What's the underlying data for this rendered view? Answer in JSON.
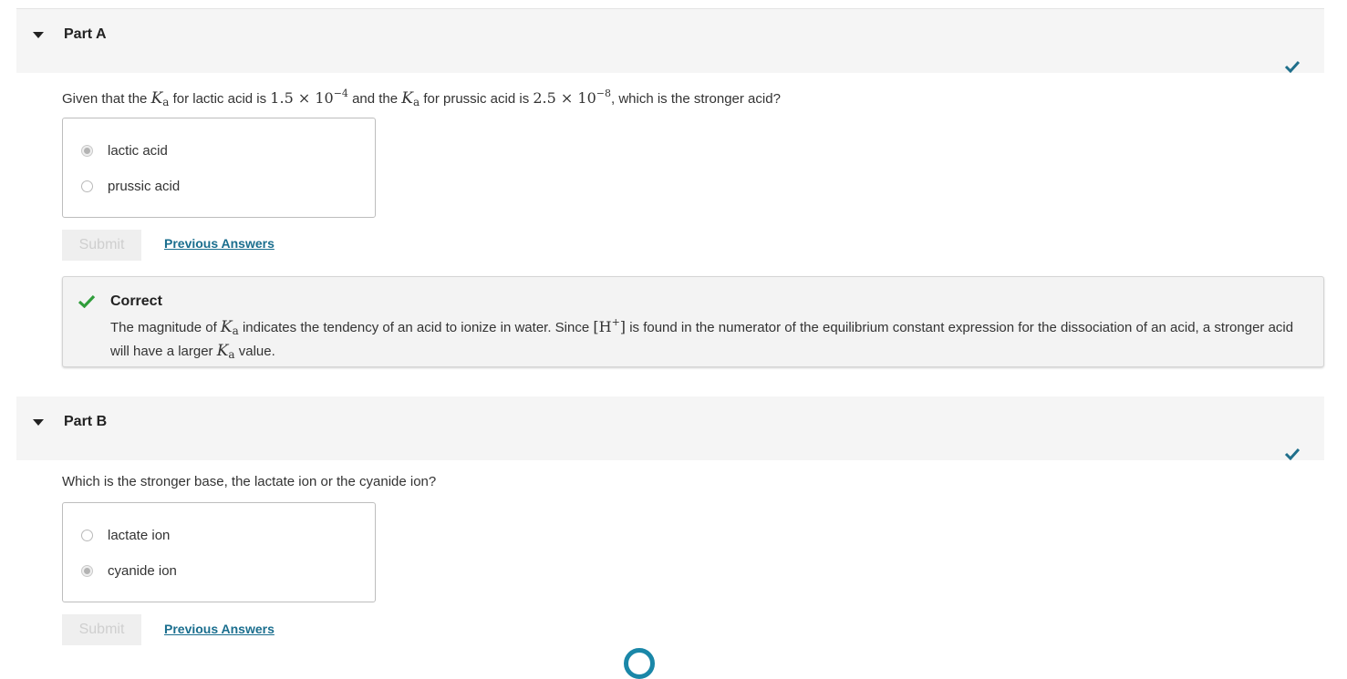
{
  "colors": {
    "check_green": "#2f9d3a",
    "header_check": "#1f6f8b",
    "link": "#1a6e8e",
    "header_bg": "#f5f5f5"
  },
  "icons": {
    "caret": "caret-down-icon",
    "header_check": "checkmark-icon",
    "feedback_check": "checkmark-icon"
  },
  "partA": {
    "title": "Part A",
    "question": {
      "t1": "Given that the ",
      "var": "K",
      "sub": "a",
      "t2": " for lactic acid is ",
      "val1": "1.5 × 10",
      "exp1": "−4",
      "t3": " and the ",
      "t4": " for prussic acid is ",
      "val2": "2.5 × 10",
      "exp2": "−8",
      "t5": ", which is the stronger acid?"
    },
    "options": [
      {
        "label": "lactic acid",
        "selected": true
      },
      {
        "label": "prussic acid",
        "selected": false
      }
    ],
    "submit_label": "Submit",
    "previous_answers_label": "Previous Answers",
    "feedback": {
      "title": "Correct",
      "b1": "The magnitude of ",
      "b2": " indicates the tendency of an acid to ionize in water. Since ",
      "h": "[H",
      "hsup": "+",
      "hclose": "]",
      "b3": " is found in the numerator of the equilibrium constant expression for the dissociation of an acid, a stronger acid will have a larger ",
      "b4": " value."
    }
  },
  "partB": {
    "title": "Part B",
    "question": "Which is the stronger base, the lactate ion or the cyanide ion?",
    "options": [
      {
        "label": "lactate ion",
        "selected": false
      },
      {
        "label": "cyanide ion",
        "selected": true
      }
    ],
    "submit_label": "Submit",
    "previous_answers_label": "Previous Answers"
  }
}
